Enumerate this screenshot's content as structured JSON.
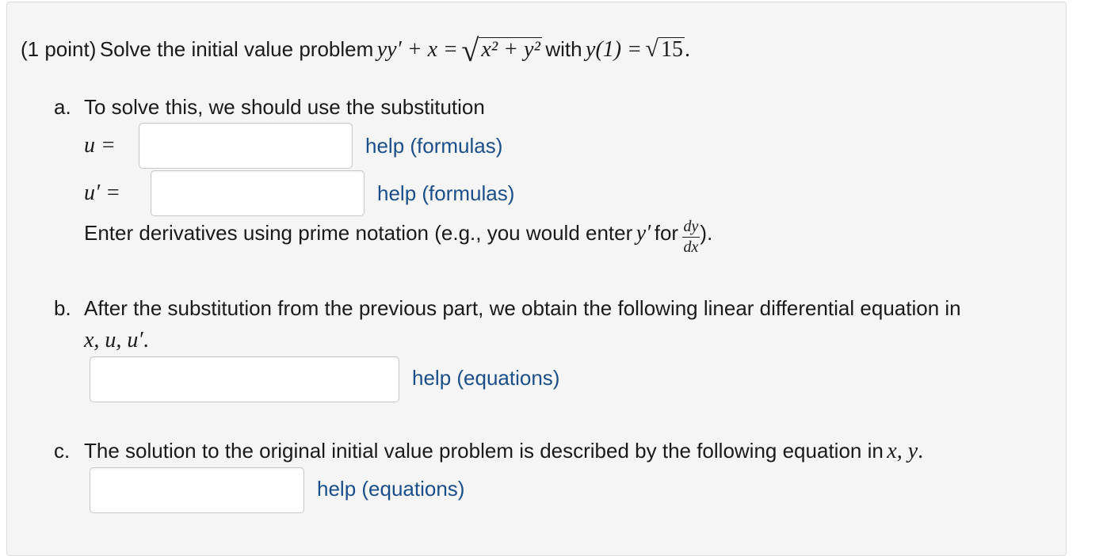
{
  "problem": {
    "points": "(1 point)",
    "prompt": "Solve the initial value problem",
    "equation_lhs": "yy′ + x =",
    "radicand": "x² + y²",
    "with_text": "with",
    "condition_lhs": "y(1) =",
    "condition_radicand": "15",
    "period": "."
  },
  "part_a": {
    "marker": "a.",
    "intro": "To solve this, we should use the substitution",
    "u_label": "u =",
    "u_value": "",
    "u_help": "help (formulas)",
    "uprime_label": "u′ =",
    "uprime_value": "",
    "uprime_help": "help (formulas)",
    "note_prefix": "Enter derivatives using prime notation (e.g., you would enter",
    "note_math": "y′",
    "note_for": "for",
    "frac_num": "dy",
    "frac_den": "dx",
    "note_suffix": ")."
  },
  "part_b": {
    "marker": "b.",
    "text": "After the substitution from the previous part, we obtain the following linear differential equation in",
    "vars": "x, u, u′",
    "vars_period": ".",
    "answer_value": "",
    "help": "help (equations)"
  },
  "part_c": {
    "marker": "c.",
    "text": "The solution to the original initial value problem is described by the following equation in",
    "vars": "x, y",
    "vars_period": ".",
    "answer_value": "",
    "help": "help (equations)"
  }
}
